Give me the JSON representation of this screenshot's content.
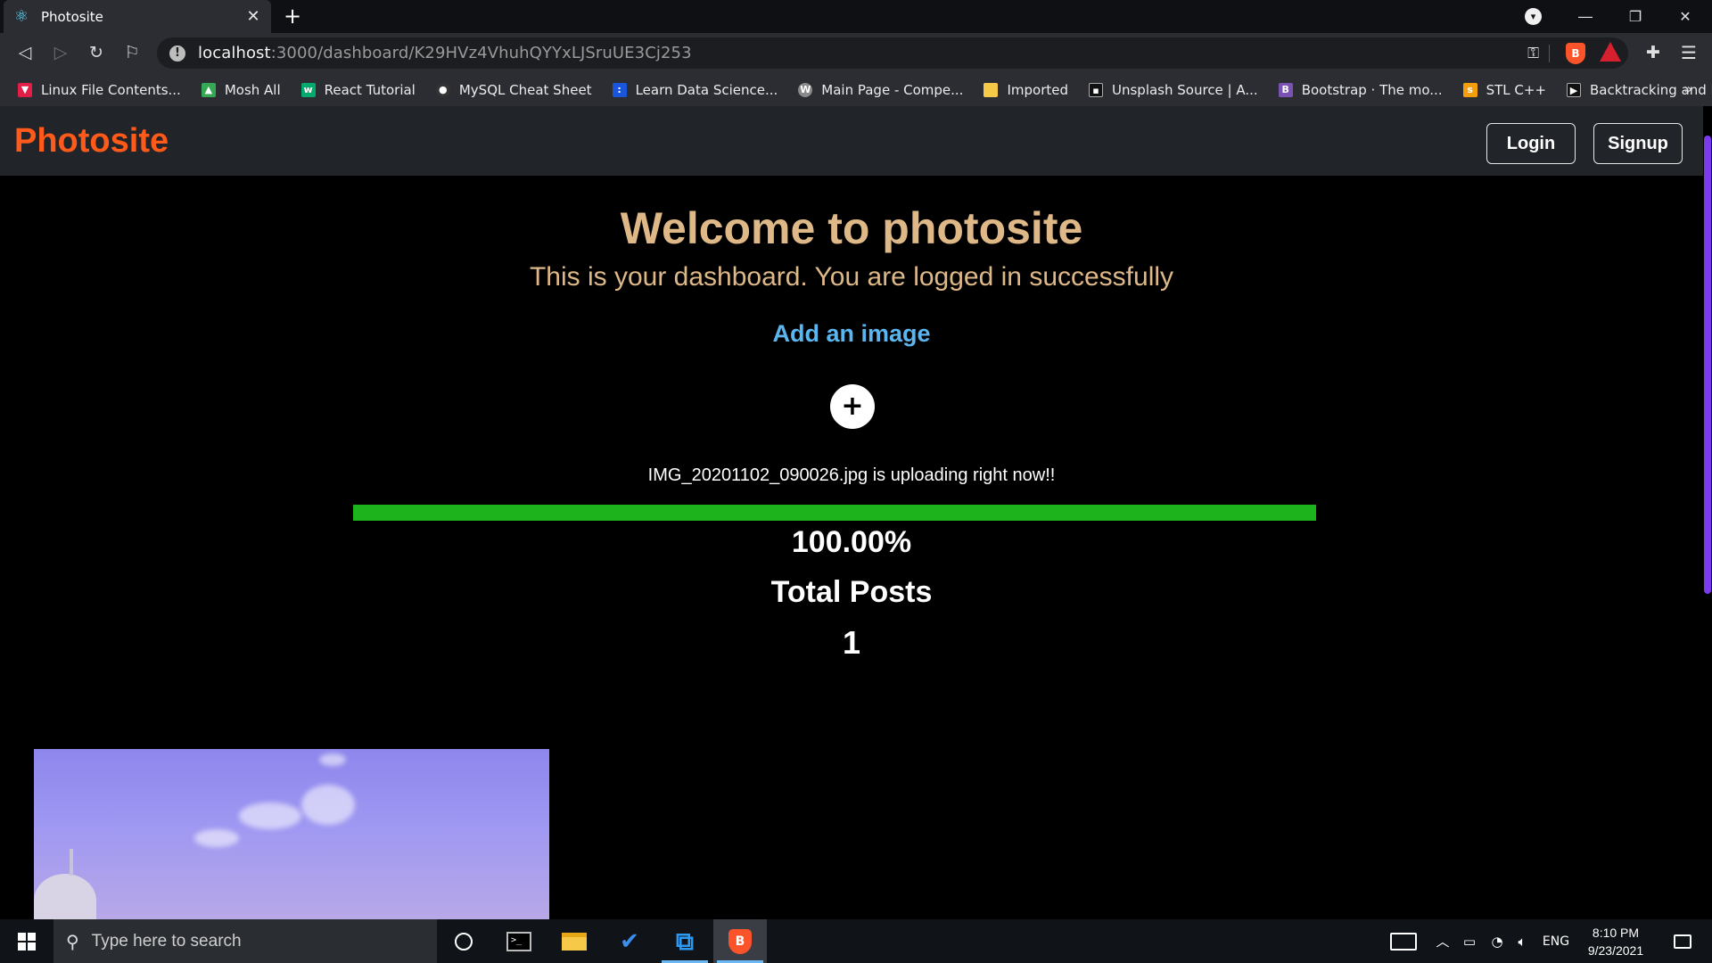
{
  "browser": {
    "tab_title": "Photosite",
    "url_host": "localhost",
    "url_path": ":3000/dashboard/K29HVz4VhuhQYYxLJSruUE3Cj253",
    "bookmarks": [
      {
        "label": "Linux File Contents...",
        "icon": "linux-icon",
        "color": "#e11d48"
      },
      {
        "label": "Mosh All",
        "icon": "google-drive-icon",
        "color": "#34a853"
      },
      {
        "label": "React Tutorial",
        "icon": "w3schools-icon",
        "color": "#04aa6d"
      },
      {
        "label": "MySQL Cheat Sheet",
        "icon": "github-icon",
        "color": "#333333"
      },
      {
        "label": "Learn Data Science...",
        "icon": "data-science-icon",
        "color": "#1a56db"
      },
      {
        "label": "Main Page - Compe...",
        "icon": "wiki-icon",
        "color": "#8a8a8a"
      },
      {
        "label": "Imported",
        "icon": "folder-icon",
        "color": "#f7c948"
      },
      {
        "label": "Unsplash Source | A...",
        "icon": "unsplash-icon",
        "color": "#111111"
      },
      {
        "label": "Bootstrap · The mo...",
        "icon": "bootstrap-icon",
        "color": "#7952b3"
      },
      {
        "label": "STL C++",
        "icon": "stl-icon",
        "color": "#f59e0b"
      },
      {
        "label": "Backtracking and N...",
        "icon": "backtracking-icon",
        "color": "#111111"
      }
    ]
  },
  "header": {
    "brand": "Photosite",
    "login_label": "Login",
    "signup_label": "Signup"
  },
  "main": {
    "welcome": "Welcome to photosite",
    "subtitle": "This is your dashboard. You are logged in successfully",
    "add_image_label": "Add an image",
    "add_button_symbol": "+",
    "upload_status": "IMG_20201102_090026.jpg is uploading right now!!",
    "progress_percent": 100,
    "progress_text": "100.00%",
    "total_posts_label": "Total Posts",
    "total_posts_value": "1"
  },
  "colors": {
    "brand": "#ff5a1a",
    "welcome_text": "#deb887",
    "link": "#5bb5ef",
    "progress": "#1db31d",
    "scroll_thumb": "#7c3aed"
  },
  "taskbar": {
    "search_placeholder": "Type here to search",
    "language": "ENG",
    "time": "8:10 PM",
    "date": "9/23/2021"
  }
}
